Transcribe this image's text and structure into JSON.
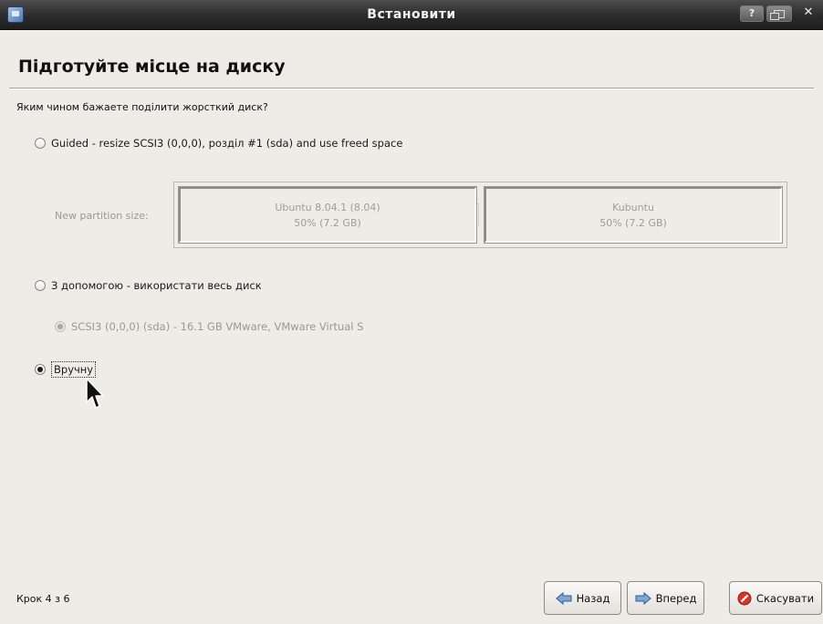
{
  "window": {
    "title": "Встановити"
  },
  "page": {
    "title": "Підготуйте місце на диску",
    "question": "Яким чином бажаете поділити жорсткий диск?"
  },
  "options": {
    "guided_resize": {
      "label": "Guided - resize SCSI3 (0,0,0), розділ #1 (sda) and use freed space",
      "selected": false
    },
    "partition_resizer": {
      "label": "New partition size:",
      "left": {
        "name": "Ubuntu 8.04.1 (8.04)",
        "size": "50% (7.2 GB)"
      },
      "right": {
        "name": "Kubuntu",
        "size": "50% (7.2 GB)"
      }
    },
    "whole_disk": {
      "label": "З допомогою - використати весь диск",
      "selected": false
    },
    "disk": {
      "label": "SCSI3 (0,0,0) (sda) - 16.1 GB VMware, VMware Virtual S",
      "selected": true,
      "enabled": false
    },
    "manual": {
      "label": "Вручну",
      "selected": true
    }
  },
  "footer": {
    "step": "Крок 4 з 6",
    "back_label": "Назад",
    "forward_label": "Вперед",
    "cancel_label": "Скасувати"
  }
}
